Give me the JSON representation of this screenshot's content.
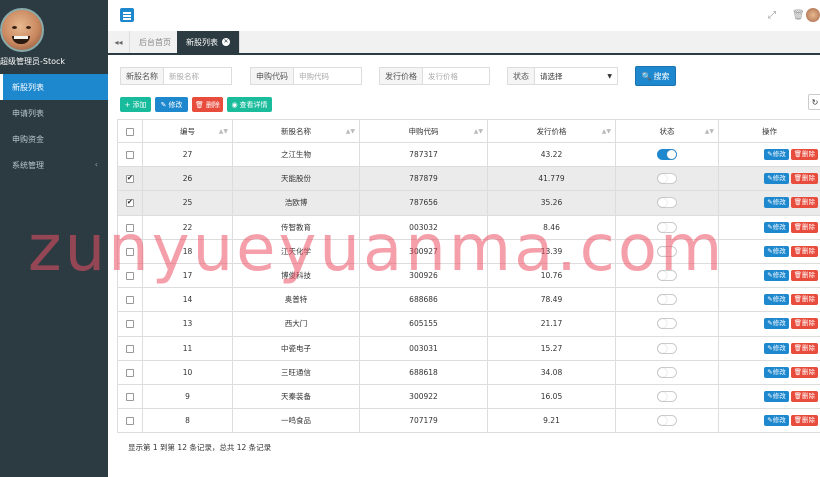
{
  "sidebar": {
    "user_name": "超级管理员-Stock",
    "items": [
      {
        "label": "新股列表",
        "active": true
      },
      {
        "label": "申请列表",
        "active": false
      },
      {
        "label": "申购资金",
        "active": false
      },
      {
        "label": "系统管理",
        "active": false,
        "has_submenu": true
      }
    ]
  },
  "header": {
    "icons": [
      "menu-icon",
      "fullscreen-icon",
      "trash-icon",
      "avatar"
    ]
  },
  "tabs": [
    {
      "label": "后台首页",
      "active": false
    },
    {
      "label": "新股列表",
      "active": true
    }
  ],
  "search": {
    "fields": [
      {
        "label": "新股名称",
        "placeholder": "新股名称"
      },
      {
        "label": "申购代码",
        "placeholder": "申购代码"
      },
      {
        "label": "发行价格",
        "placeholder": "发行价格"
      }
    ],
    "status_label": "状态",
    "status_value": "请选择",
    "search_button": "搜索"
  },
  "toolbar": {
    "add": "添加",
    "edit": "修改",
    "delete": "删除",
    "view": "查看详情"
  },
  "table": {
    "columns": [
      "编号",
      "新股名称",
      "申购代码",
      "发行价格",
      "状态",
      "操作"
    ],
    "rows": [
      {
        "id": "27",
        "name": "之江生物",
        "code": "787317",
        "price": "43.22",
        "status": true,
        "checked": false
      },
      {
        "id": "26",
        "name": "天能股份",
        "code": "787879",
        "price": "41.779",
        "status": false,
        "checked": true
      },
      {
        "id": "25",
        "name": "浩欧博",
        "code": "787656",
        "price": "35.26",
        "status": false,
        "checked": true
      },
      {
        "id": "22",
        "name": "传智教育",
        "code": "003032",
        "price": "8.46",
        "status": false,
        "checked": false
      },
      {
        "id": "18",
        "name": "江天化学",
        "code": "300927",
        "price": "13.39",
        "status": false,
        "checked": false
      },
      {
        "id": "17",
        "name": "博俊科技",
        "code": "300926",
        "price": "10.76",
        "status": false,
        "checked": false
      },
      {
        "id": "14",
        "name": "奥普特",
        "code": "688686",
        "price": "78.49",
        "status": false,
        "checked": false
      },
      {
        "id": "13",
        "name": "西大门",
        "code": "605155",
        "price": "21.17",
        "status": false,
        "checked": false
      },
      {
        "id": "11",
        "name": "中瓷电子",
        "code": "003031",
        "price": "15.27",
        "status": false,
        "checked": false
      },
      {
        "id": "10",
        "name": "三旺通信",
        "code": "688618",
        "price": "34.08",
        "status": false,
        "checked": false
      },
      {
        "id": "9",
        "name": "天秦装备",
        "code": "300922",
        "price": "16.05",
        "status": false,
        "checked": false
      },
      {
        "id": "8",
        "name": "一鸣食品",
        "code": "707179",
        "price": "9.21",
        "status": false,
        "checked": false
      }
    ],
    "row_edit": "修改",
    "row_delete": "删除"
  },
  "footer": {
    "info": "显示第 1 到第 12 条记录，总共 12 条记录"
  },
  "watermark": "zunyueyuanma.com"
}
